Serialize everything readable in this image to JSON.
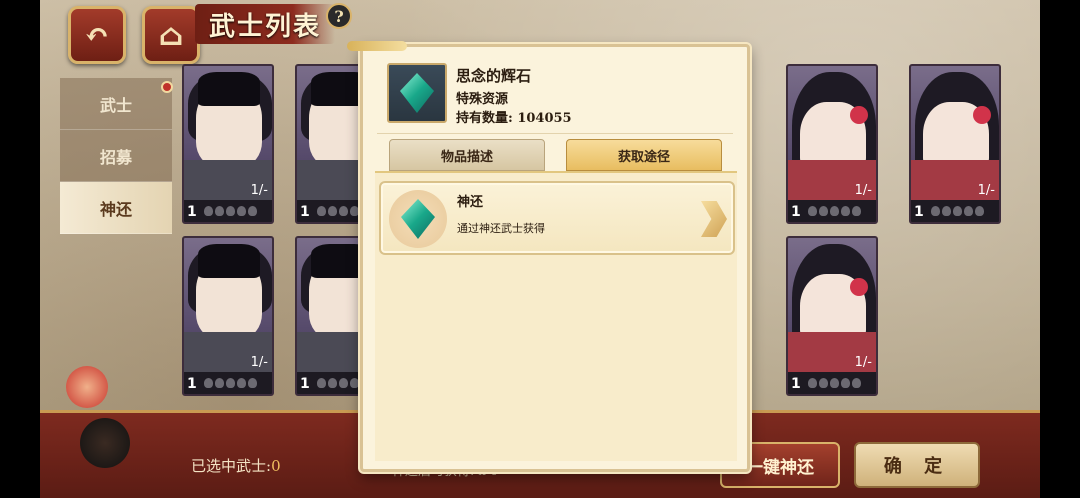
{
  "header": {
    "title": "武士列表",
    "help": "?",
    "back_icon": "back-arrow-icon",
    "home_icon": "home-icon"
  },
  "sidebar": {
    "items": [
      {
        "label": "武士"
      },
      {
        "label": "招募"
      },
      {
        "label": "神还"
      }
    ]
  },
  "cards": [
    {
      "level": "1",
      "count": "1/-"
    },
    {
      "level": "1",
      "count": ""
    },
    {
      "level": "1",
      "count": "1/-"
    },
    {
      "level": "1",
      "count": "1/-"
    },
    {
      "level": "1",
      "count": "1/-"
    },
    {
      "level": "1",
      "count": ""
    },
    {
      "level": "1",
      "count": "1/-"
    }
  ],
  "bottom": {
    "selected_label": "已选中武士:",
    "selected_count": "0",
    "gain_label": "神还后可获得:",
    "gain_count": "x 0",
    "one_click_label": "一键神还",
    "confirm_label": "确 定"
  },
  "popup": {
    "item_name": "思念的辉石",
    "item_type": "特殊资源",
    "item_qty": "持有数量: 104055",
    "tabs": [
      {
        "label": "物品描述"
      },
      {
        "label": "获取途径"
      }
    ],
    "active_tab": "获取途径",
    "source": {
      "title": "神还",
      "desc": "通过神还武士获得"
    }
  },
  "colors": {
    "accent": "#8d2b1e",
    "gold": "#d9b36a",
    "panel": "#fbf3dc"
  }
}
